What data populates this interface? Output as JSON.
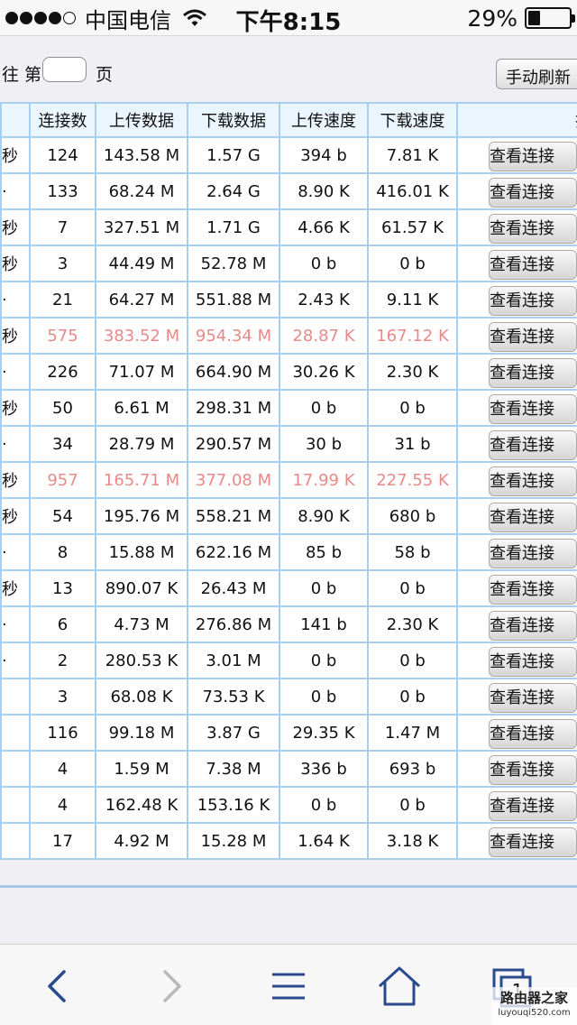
{
  "status_bar": {
    "carrier": "中国电信",
    "time": "下午8:15",
    "battery_percent": "29%",
    "battery_level": 0.29,
    "signal_dots_filled": 4,
    "signal_dots_total": 5
  },
  "pager": {
    "goto_label": "往 第",
    "page_value": "",
    "unit_label": "页",
    "refresh_label": "手动刷新"
  },
  "table": {
    "headers": [
      "",
      "连接数",
      "上传数据",
      "下载数据",
      "上传速度",
      "下载速度",
      "操"
    ],
    "view_label": "查看连接",
    "alert_color": "#e88a88",
    "rows": [
      {
        "c0": "秒",
        "conn": "124",
        "up_data": "143.58 M",
        "down_data": "1.57 G",
        "up_speed": "394 b",
        "down_speed": "7.81 K",
        "alert": false
      },
      {
        "c0": "·",
        "conn": "133",
        "up_data": "68.24 M",
        "down_data": "2.64 G",
        "up_speed": "8.90 K",
        "down_speed": "416.01 K",
        "alert": false
      },
      {
        "c0": "秒",
        "conn": "7",
        "up_data": "327.51 M",
        "down_data": "1.71 G",
        "up_speed": "4.66 K",
        "down_speed": "61.57 K",
        "alert": false
      },
      {
        "c0": "秒",
        "conn": "3",
        "up_data": "44.49 M",
        "down_data": "52.78 M",
        "up_speed": "0 b",
        "down_speed": "0 b",
        "alert": false
      },
      {
        "c0": "·",
        "conn": "21",
        "up_data": "64.27 M",
        "down_data": "551.88 M",
        "up_speed": "2.43 K",
        "down_speed": "9.11 K",
        "alert": false
      },
      {
        "c0": "秒",
        "conn": "575",
        "up_data": "383.52 M",
        "down_data": "954.34 M",
        "up_speed": "28.87 K",
        "down_speed": "167.12 K",
        "alert": true
      },
      {
        "c0": "·",
        "conn": "226",
        "up_data": "71.07 M",
        "down_data": "664.90 M",
        "up_speed": "30.26 K",
        "down_speed": "2.30 K",
        "alert": false
      },
      {
        "c0": "秒",
        "conn": "50",
        "up_data": "6.61 M",
        "down_data": "298.31 M",
        "up_speed": "0 b",
        "down_speed": "0 b",
        "alert": false
      },
      {
        "c0": "·",
        "conn": "34",
        "up_data": "28.79 M",
        "down_data": "290.57 M",
        "up_speed": "30 b",
        "down_speed": "31 b",
        "alert": false
      },
      {
        "c0": "秒",
        "conn": "957",
        "up_data": "165.71 M",
        "down_data": "377.08 M",
        "up_speed": "17.99 K",
        "down_speed": "227.55 K",
        "alert": true
      },
      {
        "c0": "秒",
        "conn": "54",
        "up_data": "195.76 M",
        "down_data": "558.21 M",
        "up_speed": "8.90 K",
        "down_speed": "680 b",
        "alert": false
      },
      {
        "c0": "·",
        "conn": "8",
        "up_data": "15.88 M",
        "down_data": "622.16 M",
        "up_speed": "85 b",
        "down_speed": "58 b",
        "alert": false
      },
      {
        "c0": "秒",
        "conn": "13",
        "up_data": "890.07 K",
        "down_data": "26.43 M",
        "up_speed": "0 b",
        "down_speed": "0 b",
        "alert": false
      },
      {
        "c0": "·",
        "conn": "6",
        "up_data": "4.73 M",
        "down_data": "276.86 M",
        "up_speed": "141 b",
        "down_speed": "2.30 K",
        "alert": false
      },
      {
        "c0": "·",
        "conn": "2",
        "up_data": "280.53 K",
        "down_data": "3.01 M",
        "up_speed": "0 b",
        "down_speed": "0 b",
        "alert": false
      },
      {
        "c0": "",
        "conn": "3",
        "up_data": "68.08 K",
        "down_data": "73.53 K",
        "up_speed": "0 b",
        "down_speed": "0 b",
        "alert": false
      },
      {
        "c0": "",
        "conn": "116",
        "up_data": "99.18 M",
        "down_data": "3.87 G",
        "up_speed": "29.35 K",
        "down_speed": "1.47 M",
        "alert": false
      },
      {
        "c0": "",
        "conn": "4",
        "up_data": "1.59 M",
        "down_data": "7.38 M",
        "up_speed": "336 b",
        "down_speed": "693 b",
        "alert": false
      },
      {
        "c0": "",
        "conn": "4",
        "up_data": "162.48 K",
        "down_data": "153.16 K",
        "up_speed": "0 b",
        "down_speed": "0 b",
        "alert": false
      },
      {
        "c0": "",
        "conn": "17",
        "up_data": "4.92 M",
        "down_data": "15.28 M",
        "up_speed": "1.64 K",
        "down_speed": "3.18 K",
        "alert": false
      }
    ]
  },
  "toolbar": {
    "back_icon": "chevron-left-icon",
    "forward_icon": "chevron-right-icon",
    "menu_icon": "hamburger-icon",
    "home_icon": "home-icon",
    "tabs_icon": "tabs-icon",
    "tabs_count": "1"
  },
  "watermark": {
    "main": "路由器之家",
    "sub": "luyouqi520.com"
  }
}
